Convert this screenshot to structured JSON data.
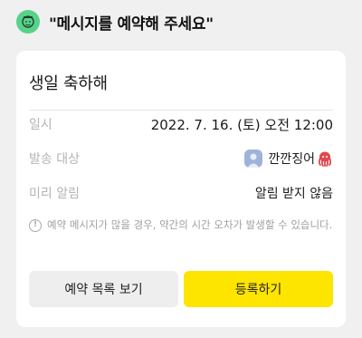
{
  "header": {
    "title": "\"메시지를 예약해 주세요\"",
    "avatar_icon": "bot-face-icon",
    "avatar_color": "#57d28a"
  },
  "card": {
    "title": "생일 축하해",
    "rows": [
      {
        "label": "일시",
        "value": "2022. 7. 16. (토) 오전 12:00"
      },
      {
        "label": "발송 대상",
        "value": "깐깐징어",
        "icon": "user-avatar-icon",
        "emoji_icon": "octopus-icon"
      },
      {
        "label": "미리 알림",
        "value": "알림 받지 않음"
      }
    ],
    "notice": "예약 메시지가 많을 경우, 약간의 시간 오차가 발생할 수 있습니다.",
    "notice_icon": "exclamation-circle-icon"
  },
  "buttons": {
    "list_label": "예약 목록 보기",
    "register_label": "등록하기",
    "register_color": "#fee500"
  }
}
